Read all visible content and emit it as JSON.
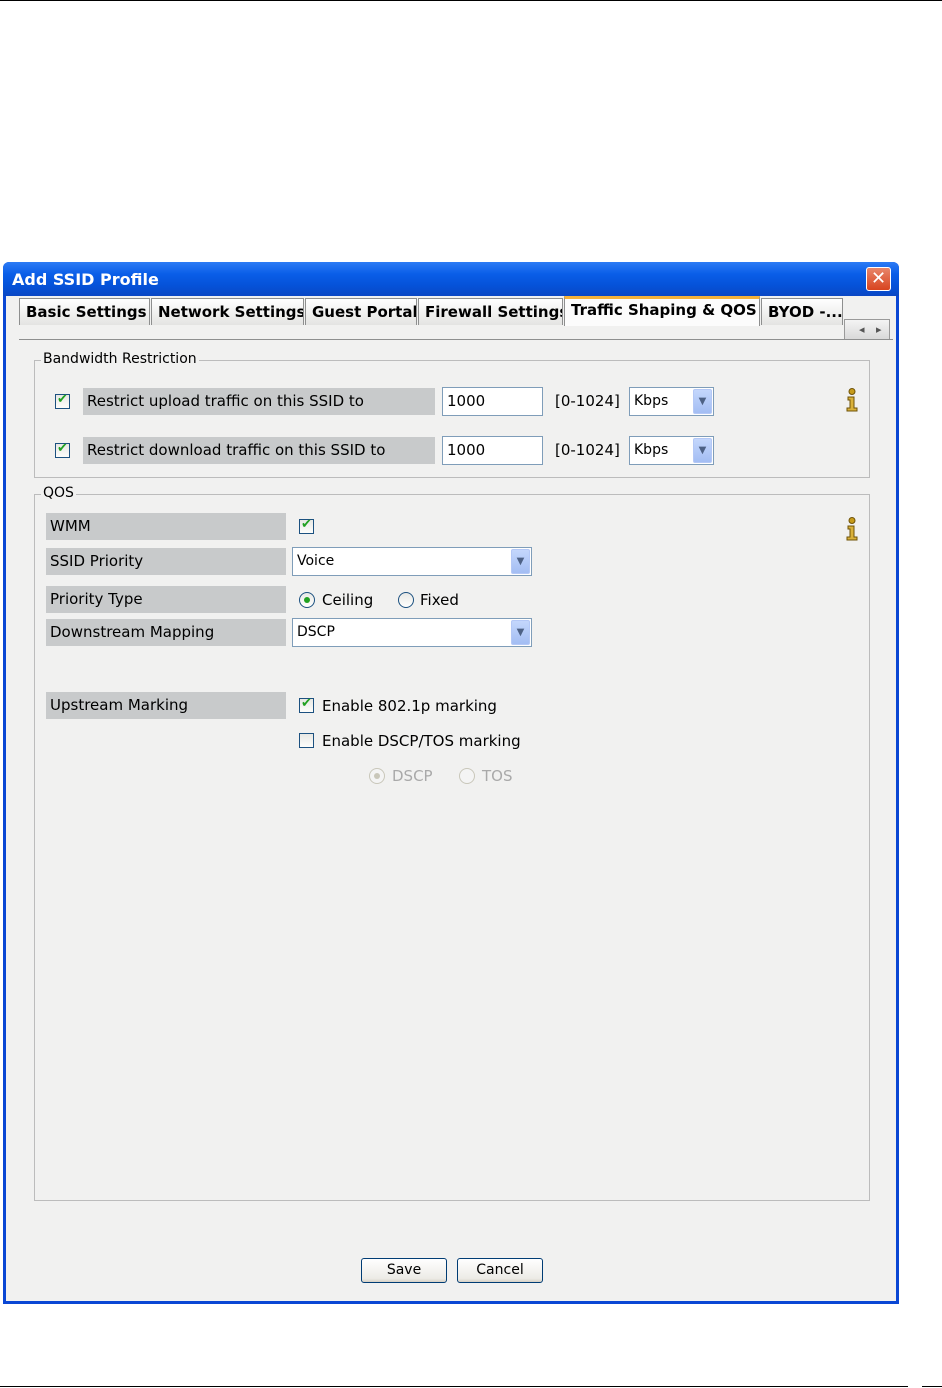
{
  "dialog": {
    "title": "Add SSID Profile",
    "close_label": "✕"
  },
  "tabs": [
    {
      "label": "Basic Settings",
      "active": false
    },
    {
      "label": "Network Settings",
      "active": false
    },
    {
      "label": "Guest Portal",
      "active": false
    },
    {
      "label": "Firewall Settings",
      "active": false
    },
    {
      "label": "Traffic Shaping & QOS",
      "active": true
    },
    {
      "label": "BYOD -...",
      "active": false
    }
  ],
  "bandwidth": {
    "legend": "Bandwidth Restriction",
    "upload": {
      "label": "Restrict upload traffic on this SSID to",
      "checked": true,
      "value": "1000",
      "range": "[0-1024]",
      "unit": "Kbps"
    },
    "download": {
      "label": "Restrict download traffic on this SSID to",
      "checked": true,
      "value": "1000",
      "range": "[0-1024]",
      "unit": "Kbps"
    }
  },
  "qos": {
    "legend": "QOS",
    "wmm": {
      "label": "WMM",
      "checked": true
    },
    "ssid_priority": {
      "label": "SSID Priority",
      "value": "Voice"
    },
    "priority_type": {
      "label": "Priority Type",
      "options": [
        "Ceiling",
        "Fixed"
      ],
      "selected": "Ceiling"
    },
    "downstream_mapping": {
      "label": "Downstream Mapping",
      "value": "DSCP"
    },
    "upstream_marking": {
      "label": "Upstream Marking",
      "enable_8021p": {
        "label": "Enable 802.1p marking",
        "checked": true
      },
      "enable_dscp_tos": {
        "label": "Enable DSCP/TOS marking",
        "checked": false
      },
      "marking_options": [
        "DSCP",
        "TOS"
      ],
      "marking_selected": "DSCP"
    }
  },
  "buttons": {
    "save": "Save",
    "cancel": "Cancel"
  },
  "colors": {
    "title_bar": "#0a5ee8",
    "accent_check": "#21a121",
    "active_tab_highlight": "#f5b23a"
  }
}
